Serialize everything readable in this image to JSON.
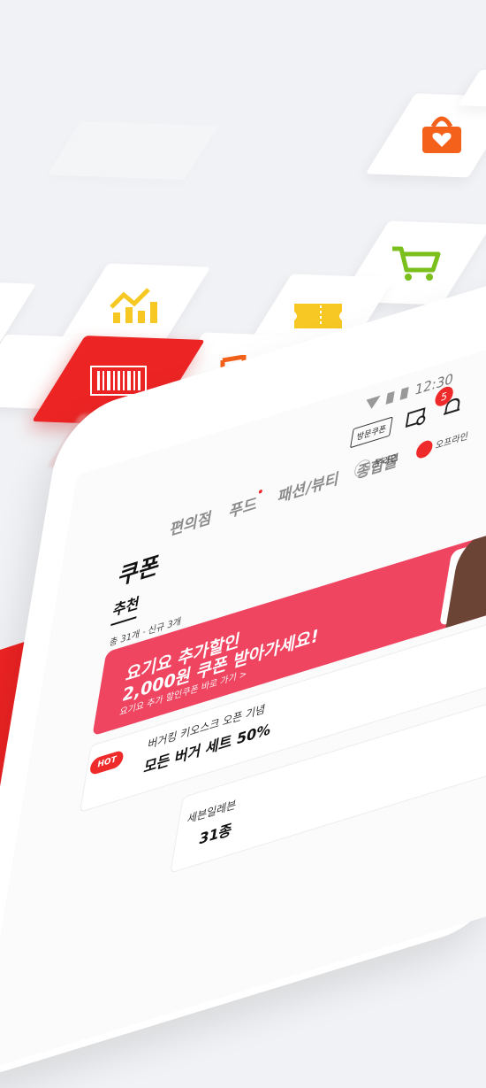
{
  "status_bar": {
    "time": "12:30"
  },
  "header": {
    "visit_coupon_label": "방문쿠폰",
    "notification_count": "5"
  },
  "category_tabs": [
    "편의점",
    "푸드",
    "패션/뷰티",
    "종합몰"
  ],
  "page_title": "쿠폰",
  "subtabs": {
    "active": "추천"
  },
  "filters": {
    "online": "온라인",
    "offline": "오프라인"
  },
  "coupon_count": "총 31개 · 신규 3개",
  "banner": {
    "line1": "요기요 추가할인",
    "line2": "2,000원 쿠폰 받아가세요!",
    "line3": "요기요 추가 할인쿠폰 바로 가기 >"
  },
  "coupons": [
    {
      "badge": "HOT",
      "subtitle": "버거킹 키오스크 오픈 기념",
      "title": "모든 버거 세트 50%"
    },
    {
      "subtitle": "세븐일레븐",
      "title": "31종"
    }
  ],
  "feature_icons": [
    "gift-bag-icon",
    "shopping-cart-icon",
    "ticket-icon",
    "chart-icon",
    "barcode-icon",
    "music-note-icon"
  ],
  "colors": {
    "brand_red": "#ec2424",
    "orange": "#f4611b",
    "yellow": "#f7c823",
    "green": "#7bbf1c",
    "banner_pink": "#ef4561"
  }
}
